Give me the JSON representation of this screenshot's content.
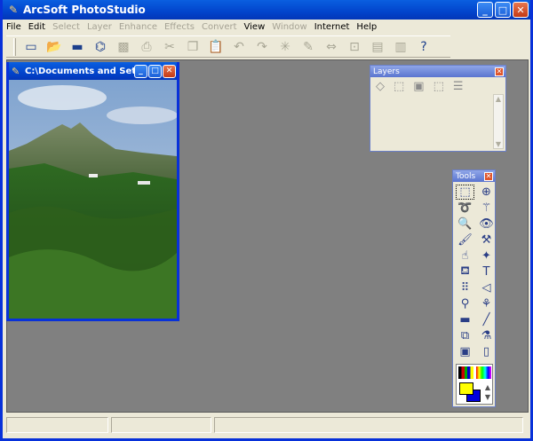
{
  "window": {
    "title": "ArcSoft PhotoStudio",
    "minimize": "_",
    "maximize": "□",
    "close": "✕"
  },
  "menu": [
    {
      "label": "File",
      "enabled": true
    },
    {
      "label": "Edit",
      "enabled": true
    },
    {
      "label": "Select",
      "enabled": false
    },
    {
      "label": "Layer",
      "enabled": false
    },
    {
      "label": "Enhance",
      "enabled": false
    },
    {
      "label": "Effects",
      "enabled": false
    },
    {
      "label": "Convert",
      "enabled": false
    },
    {
      "label": "View",
      "enabled": true
    },
    {
      "label": "Window",
      "enabled": false
    },
    {
      "label": "Internet",
      "enabled": true
    },
    {
      "label": "Help",
      "enabled": true
    }
  ],
  "toolbar": {
    "icons": [
      "new-icon",
      "open-icon",
      "save-icon",
      "scan-icon",
      "acquire-icon",
      "print-icon",
      "cut-icon",
      "copy-icon",
      "paste-icon",
      "undo-icon",
      "redo-icon",
      "magic-icon",
      "eraser-icon",
      "resize-icon",
      "crop-icon",
      "album-icon",
      "slideshow-icon",
      "help-icon"
    ],
    "glyphs": [
      "▭",
      "📂",
      "▬",
      "⌬",
      "▩",
      "⎙",
      "✂",
      "❐",
      "📋",
      "↶",
      "↷",
      "✳",
      "✎",
      "⇔",
      "⊡",
      "▤",
      "▥",
      "?"
    ],
    "enabled": [
      true,
      true,
      true,
      true,
      false,
      false,
      false,
      false,
      false,
      false,
      false,
      false,
      false,
      false,
      false,
      false,
      false,
      true
    ]
  },
  "document": {
    "title": "C:\\Documents and Set..."
  },
  "layers": {
    "title": "Layers",
    "close": "✕",
    "icons": [
      "◇",
      "⬚",
      "▣",
      "⬚",
      "☰"
    ]
  },
  "tools": {
    "title": "Tools",
    "close": "✕",
    "items": [
      {
        "name": "rect-select-icon",
        "glyph": "⬚"
      },
      {
        "name": "move-select-icon",
        "glyph": "⊕"
      },
      {
        "name": "lasso-icon",
        "glyph": "➰"
      },
      {
        "name": "magic-wand-icon",
        "glyph": "⚚"
      },
      {
        "name": "zoom-icon",
        "glyph": "🔍"
      },
      {
        "name": "red-eye-icon",
        "glyph": "👁"
      },
      {
        "name": "brush-icon",
        "glyph": "🖌"
      },
      {
        "name": "clone-icon",
        "glyph": "⚒"
      },
      {
        "name": "smudge-icon",
        "glyph": "☝"
      },
      {
        "name": "blur-icon",
        "glyph": "✦"
      },
      {
        "name": "fill-icon",
        "glyph": "⛾"
      },
      {
        "name": "text-icon",
        "glyph": "T"
      },
      {
        "name": "airbrush-icon",
        "glyph": "⠿"
      },
      {
        "name": "shape-icon",
        "glyph": "◁"
      },
      {
        "name": "stamp-icon",
        "glyph": "⚲"
      },
      {
        "name": "retouch-icon",
        "glyph": "⚘"
      },
      {
        "name": "gradient-icon",
        "glyph": "▬"
      },
      {
        "name": "line-icon",
        "glyph": "╱"
      },
      {
        "name": "crop-tool-icon",
        "glyph": "⧉"
      },
      {
        "name": "eyedropper-icon",
        "glyph": "⚗"
      },
      {
        "name": "frame-icon",
        "glyph": "▣"
      },
      {
        "name": "eraser-tool-icon",
        "glyph": "▯"
      }
    ]
  },
  "colors": {
    "foreground": "#ffff00",
    "background": "#0000dd"
  }
}
